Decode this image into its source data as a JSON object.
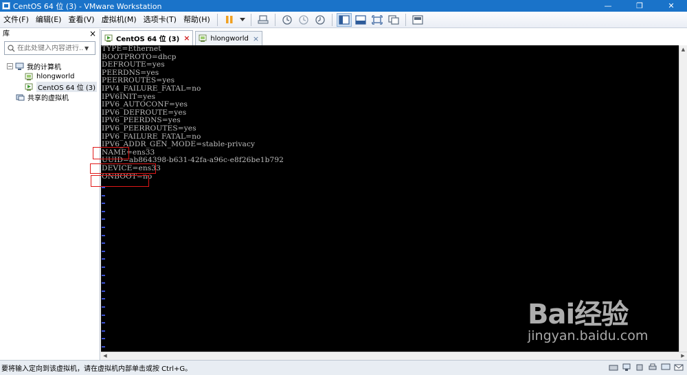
{
  "window": {
    "title": "CentOS 64 位 (3) - VMware Workstation",
    "minimize": "—",
    "restore": "❐",
    "close": "✕"
  },
  "menu": {
    "items": [
      "文件(F)",
      "编辑(E)",
      "查看(V)",
      "虚拟机(M)",
      "选项卡(T)",
      "帮助(H)"
    ]
  },
  "toolbar": {
    "icons": [
      "pause-icon",
      "dropdown-arrow-icon",
      "send-keys-icon",
      "snapshot-icon",
      "revert-snapshot-icon",
      "snapshot-manager-icon",
      "sidebar-view-icon",
      "console-view-icon",
      "fullscreen-icon",
      "unity-icon",
      "thumbnail-icon"
    ]
  },
  "library": {
    "title": "库",
    "close": "×",
    "search_placeholder": "在此处键入内容进行...",
    "tree": [
      {
        "label": "我的计算机",
        "icon": "computer-icon",
        "expander": "−"
      },
      {
        "label": "hlongworld",
        "icon": "vm-icon"
      },
      {
        "label": "CentOS 64 位 (3)",
        "icon": "vm-running-icon",
        "selected": true
      },
      {
        "label": "共享的虚拟机",
        "icon": "shared-vm-icon"
      }
    ]
  },
  "tabs": [
    {
      "label": "CentOS 64 位 (3)",
      "active": true,
      "close": "×"
    },
    {
      "label": "hlongworld",
      "active": false,
      "close": "×"
    }
  ],
  "console": {
    "lines": [
      "TYPE=Ethernet",
      "BOOTPROTO=dhcp",
      "DEFROUTE=yes",
      "PEERDNS=yes",
      "PEERROUTES=yes",
      "IPV4_FAILURE_FATAL=no",
      "IPV6INIT=yes",
      "IPV6_AUTOCONF=yes",
      "IPV6_DEFROUTE=yes",
      "IPV6_PEERDNS=yes",
      "IPV6_PEERROUTES=yes",
      "IPV6_FAILURE_FATAL=no",
      "IPV6_ADDR_GEN_MODE=stable-privacy",
      "NAME=ens33",
      "UUID=ab864398-b631-42fa-a96c-e8f26be1b792",
      "DEVICE=ens33",
      "ONBOOT=no"
    ],
    "tilde_count": 22,
    "highlighted": [
      "NAME=ens33",
      "DEVICE=ens33",
      "ONBOOT=no"
    ]
  },
  "status": {
    "text": "要将输入定向到该虚拟机，请在虚拟机内部单击或按 Ctrl+G。"
  },
  "watermark": {
    "brand": "Bai经验",
    "url": "jingyan.baidu.com"
  },
  "colors": {
    "titlebar": "#1a73c9",
    "console_bg": "#000000",
    "console_text": "#bcbcbc",
    "tilde": "#3a4fd0",
    "highlight_box": "#e01818"
  }
}
